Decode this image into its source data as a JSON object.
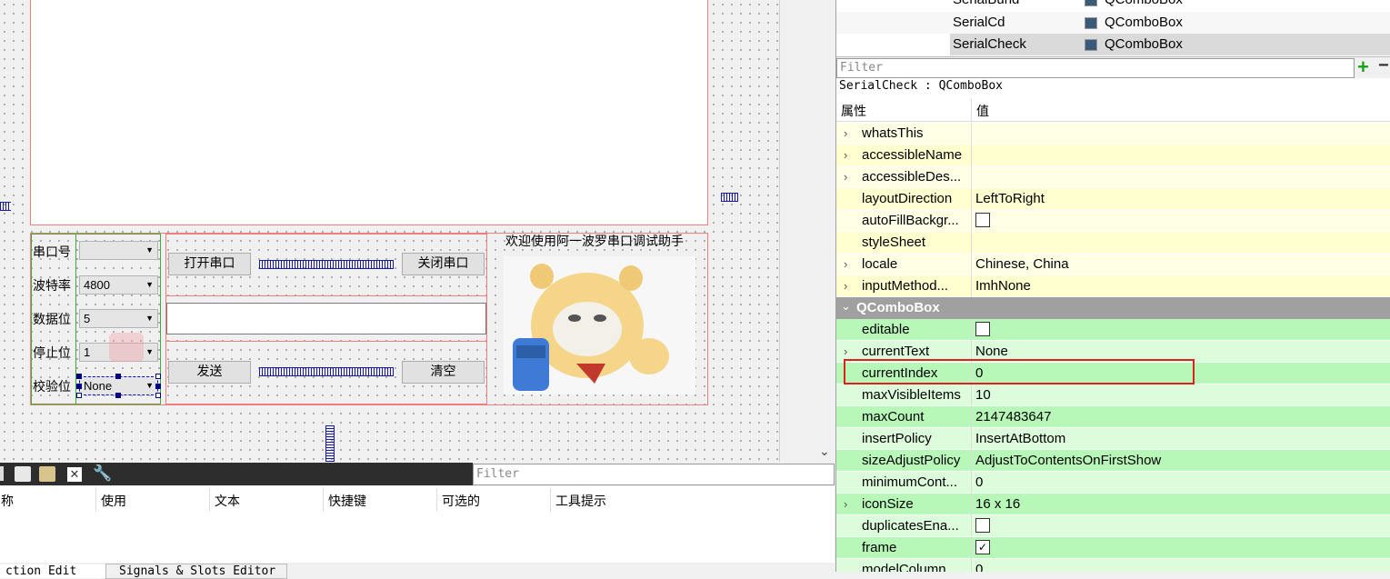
{
  "form": {
    "labels": [
      "串口号",
      "波特率",
      "数据位",
      "停止位",
      "校验位"
    ],
    "combos": [
      "",
      "4800",
      "5",
      "1",
      "None"
    ],
    "open_button": "打开串口",
    "close_button": "关闭串口",
    "send_button": "发送",
    "clear_button": "清空",
    "welcome": "欢迎使用阿一波罗串口调试助手"
  },
  "object_inspector": {
    "rows": [
      {
        "name": "SerialBund",
        "type": "QComboBox"
      },
      {
        "name": "SerialCd",
        "type": "QComboBox"
      },
      {
        "name": "SerialCheck",
        "type": "QComboBox"
      }
    ],
    "filter_placeholder": "Filter",
    "add_symbol": "+",
    "remove_symbol": "−"
  },
  "property_editor": {
    "object_caption": "SerialCheck : QComboBox",
    "col_property": "属性",
    "col_value": "值",
    "group_header": "QComboBox",
    "qwidget_props": [
      {
        "name": "whatsThis",
        "value": "",
        "expandable": true
      },
      {
        "name": "accessibleName",
        "value": "",
        "expandable": true
      },
      {
        "name": "accessibleDes...",
        "value": "",
        "expandable": true
      },
      {
        "name": "layoutDirection",
        "value": "LeftToRight",
        "expandable": false
      },
      {
        "name": "autoFillBackgr...",
        "value": "",
        "checkbox": "unchecked",
        "expandable": false
      },
      {
        "name": "styleSheet",
        "value": "",
        "expandable": false
      },
      {
        "name": "locale",
        "value": "Chinese, China",
        "expandable": true
      },
      {
        "name": "inputMethod...",
        "value": "ImhNone",
        "expandable": true
      }
    ],
    "combo_props": [
      {
        "name": "editable",
        "value": "",
        "checkbox": "unchecked",
        "expandable": false
      },
      {
        "name": "currentText",
        "value": "None",
        "expandable": true
      },
      {
        "name": "currentIndex",
        "value": "0",
        "expandable": false
      },
      {
        "name": "maxVisibleItems",
        "value": "10",
        "expandable": false
      },
      {
        "name": "maxCount",
        "value": "2147483647",
        "expandable": false
      },
      {
        "name": "insertPolicy",
        "value": "InsertAtBottom",
        "expandable": false
      },
      {
        "name": "sizeAdjustPolicy",
        "value": "AdjustToContentsOnFirstShow",
        "expandable": false
      },
      {
        "name": "minimumCont...",
        "value": "0",
        "expandable": false
      },
      {
        "name": "iconSize",
        "value": "16 x 16",
        "expandable": true
      },
      {
        "name": "duplicatesEna...",
        "value": "",
        "checkbox": "unchecked",
        "expandable": false
      },
      {
        "name": "frame",
        "value": "",
        "checkbox": "checked",
        "expandable": false
      },
      {
        "name": "modelColumn",
        "value": "0",
        "expandable": false
      }
    ],
    "highlighted_property": "currentIndex"
  },
  "action_editor": {
    "filter_placeholder": "Filter",
    "columns": [
      "称",
      "使用",
      "文本",
      "快捷键",
      "可选的",
      "工具提示"
    ],
    "tabs": [
      "ction Edit",
      "Signals & Slots Editor"
    ]
  },
  "colors": {
    "yellow_row": "#ffffcf",
    "yellow_row_alt": "#ffffe6",
    "green_row": "#b7f7b7",
    "green_row_alt": "#dcfcdc",
    "group_header": "#a0a0a0",
    "highlight_box": "#e02020"
  }
}
